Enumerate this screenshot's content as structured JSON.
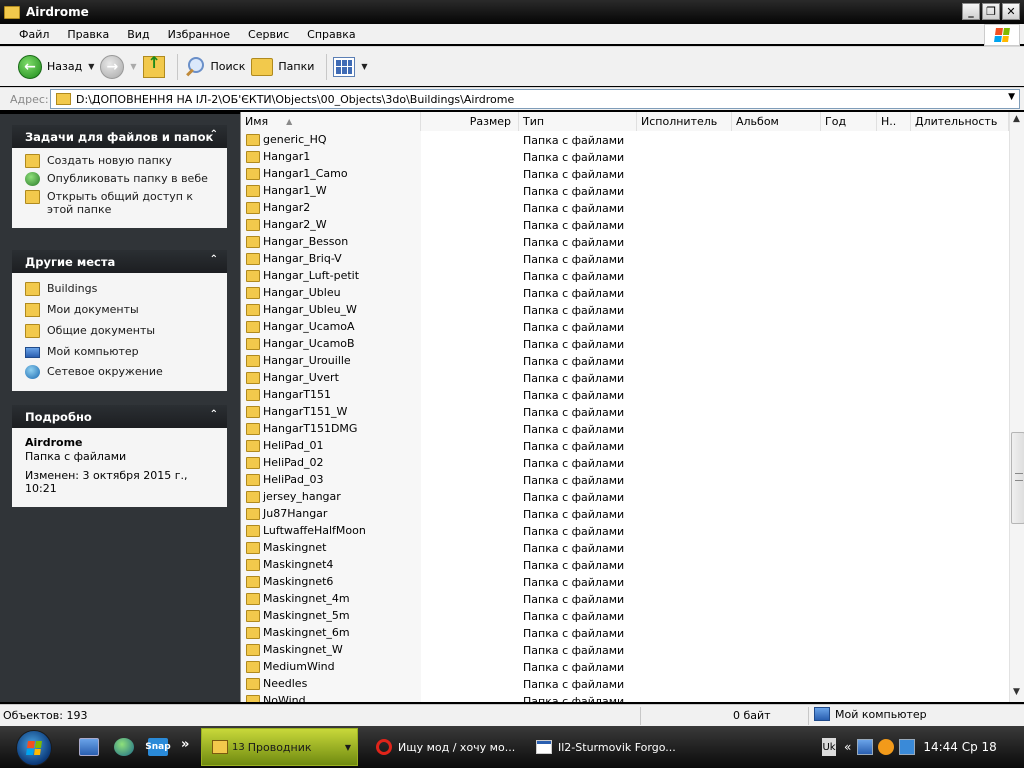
{
  "window": {
    "title": "Airdrome",
    "minimize_label": "_",
    "maximize_label": "❐",
    "close_label": "✕"
  },
  "menu": [
    "Файл",
    "Правка",
    "Вид",
    "Избранное",
    "Сервис",
    "Справка"
  ],
  "toolbar": {
    "back_label": "Назад",
    "search_label": "Поиск",
    "folders_label": "Папки",
    "back_glyph": "←",
    "forward_glyph": "→",
    "dropdown_glyph": "▼"
  },
  "address": {
    "label": "Адрес:",
    "path": "D:\\ДОПОВНЕННЯ НА ІЛ-2\\ОБ'ЄКТИ\\Objects\\00_Objects\\3do\\Buildings\\Airdrome",
    "dropdown_glyph": "▼"
  },
  "left_pane": {
    "tasks": {
      "title": "Задачи для файлов и папок",
      "collapse_glyph": "⌃",
      "items": [
        {
          "label": "Создать новую папку",
          "icon": "new-folder-icon"
        },
        {
          "label": "Опубликовать папку в вебе",
          "icon": "publish-web-icon"
        },
        {
          "label": "Открыть общий доступ к этой папке",
          "icon": "share-folder-icon"
        }
      ]
    },
    "places": {
      "title": "Другие места",
      "collapse_glyph": "⌃",
      "items": [
        {
          "label": "Buildings",
          "icon": "folder-icon"
        },
        {
          "label": "Мои документы",
          "icon": "my-documents-icon"
        },
        {
          "label": "Общие документы",
          "icon": "shared-documents-icon"
        },
        {
          "label": "Мой компьютер",
          "icon": "my-computer-icon"
        },
        {
          "label": "Сетевое окружение",
          "icon": "network-icon"
        }
      ]
    },
    "details": {
      "title": "Подробно",
      "collapse_glyph": "⌃",
      "name": "Airdrome",
      "type": "Папка с файлами",
      "modified": "Изменен: 3 октября 2015 г., 10:21"
    }
  },
  "columns": [
    "Имя",
    "Размер",
    "Тип",
    "Исполнитель",
    "Альбом",
    "Год",
    "Н..",
    "Длительность"
  ],
  "sort_glyph": "▲",
  "files": [
    {
      "name": "generic_HQ",
      "type": "Папка с файлами"
    },
    {
      "name": "Hangar1",
      "type": "Папка с файлами"
    },
    {
      "name": "Hangar1_Camo",
      "type": "Папка с файлами"
    },
    {
      "name": "Hangar1_W",
      "type": "Папка с файлами"
    },
    {
      "name": "Hangar2",
      "type": "Папка с файлами"
    },
    {
      "name": "Hangar2_W",
      "type": "Папка с файлами"
    },
    {
      "name": "Hangar_Besson",
      "type": "Папка с файлами"
    },
    {
      "name": "Hangar_Briq-V",
      "type": "Папка с файлами"
    },
    {
      "name": "Hangar_Luft-petit",
      "type": "Папка с файлами"
    },
    {
      "name": "Hangar_Ubleu",
      "type": "Папка с файлами"
    },
    {
      "name": "Hangar_Ubleu_W",
      "type": "Папка с файлами"
    },
    {
      "name": "Hangar_UcamoA",
      "type": "Папка с файлами"
    },
    {
      "name": "Hangar_UcamoB",
      "type": "Папка с файлами"
    },
    {
      "name": "Hangar_Urouille",
      "type": "Папка с файлами"
    },
    {
      "name": "Hangar_Uvert",
      "type": "Папка с файлами"
    },
    {
      "name": "HangarT151",
      "type": "Папка с файлами"
    },
    {
      "name": "HangarT151_W",
      "type": "Папка с файлами"
    },
    {
      "name": "HangarT151DMG",
      "type": "Папка с файлами"
    },
    {
      "name": "HeliPad_01",
      "type": "Папка с файлами"
    },
    {
      "name": "HeliPad_02",
      "type": "Папка с файлами"
    },
    {
      "name": "HeliPad_03",
      "type": "Папка с файлами"
    },
    {
      "name": "jersey_hangar",
      "type": "Папка с файлами"
    },
    {
      "name": "Ju87Hangar",
      "type": "Папка с файлами"
    },
    {
      "name": "LuftwaffeHalfMoon",
      "type": "Папка с файлами"
    },
    {
      "name": "Maskingnet",
      "type": "Папка с файлами"
    },
    {
      "name": "Maskingnet4",
      "type": "Папка с файлами"
    },
    {
      "name": "Maskingnet6",
      "type": "Папка с файлами"
    },
    {
      "name": "Maskingnet_4m",
      "type": "Папка с файлами"
    },
    {
      "name": "Maskingnet_5m",
      "type": "Папка с файлами"
    },
    {
      "name": "Maskingnet_6m",
      "type": "Папка с файлами"
    },
    {
      "name": "Maskingnet_W",
      "type": "Папка с файлами"
    },
    {
      "name": "MediumWind",
      "type": "Папка с файлами"
    },
    {
      "name": "Needles",
      "type": "Папка с файлами"
    },
    {
      "name": "NoWind",
      "type": "Папка с файлами"
    }
  ],
  "scrollbar": {
    "up_glyph": "▲",
    "down_glyph": "▼"
  },
  "status": {
    "objects": "Объектов: 193",
    "size": "0 байт",
    "location": "Мой компьютер"
  },
  "taskbar": {
    "snap_label": "Snap",
    "more_glyph": "»",
    "explorer_count": "13",
    "explorer_label": "Проводник",
    "opera_label": "Ищу мод / хочу мо...",
    "game_label": "Il2-Sturmovik Forgo...",
    "dropdown_glyph": "▼",
    "lang": "Uk",
    "tray_chevron": "«",
    "clock": "14:44 Ср 18"
  },
  "colors": {
    "accent_blue": "#2b4fa8",
    "accent_orange": "#e8632a",
    "taskbar_active": "#9ab020"
  }
}
